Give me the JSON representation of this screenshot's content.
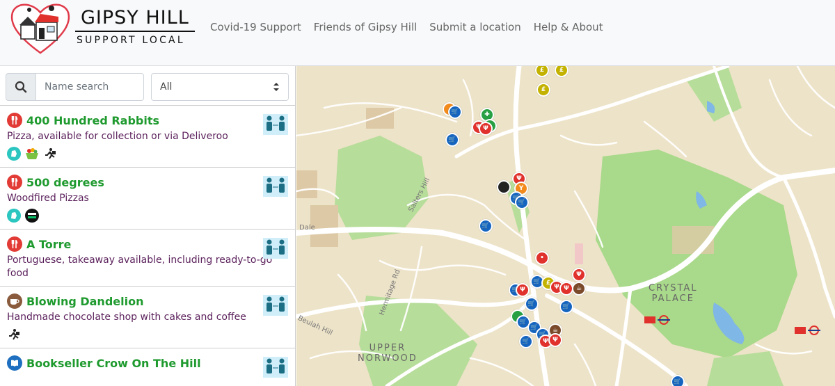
{
  "header": {
    "brand_title": "GIPSY HILL",
    "brand_subtitle": "SUPPORT LOCAL",
    "nav": [
      {
        "label": "Covid-19 Support"
      },
      {
        "label": "Friends of Gipsy Hill"
      },
      {
        "label": "Submit a location"
      },
      {
        "label": "Help & About"
      }
    ]
  },
  "search": {
    "placeholder": "Name search",
    "filter_value": "All"
  },
  "listings": [
    {
      "name": "400 Hundred Rabbits",
      "category": "food",
      "description": "Pizza, available for collection or via Deliveroo",
      "tags": [
        "deliveroo-icon",
        "basket-icon",
        "delivery-runner-icon"
      ]
    },
    {
      "name": "500 degrees",
      "category": "food",
      "description": "Woodfired Pizzas",
      "tags": [
        "deliveroo-icon",
        "uber-eats-icon"
      ]
    },
    {
      "name": "A Torre",
      "category": "food",
      "description": "Portuguese, takeaway available, including ready-to-go food",
      "tags": []
    },
    {
      "name": "Blowing Dandelion",
      "category": "coffee",
      "description": "Handmade chocolate shop with cakes and coffee",
      "tags": [
        "delivery-runner-icon"
      ]
    },
    {
      "name": "Bookseller Crow On The Hill",
      "category": "book",
      "description": "",
      "tags": []
    }
  ],
  "map": {
    "labels": {
      "crystal_palace_1": "CRYSTAL",
      "crystal_palace_2": "PALACE",
      "upper_norwood_1": "UPPER",
      "upper_norwood_2": "NORWOOD",
      "salters_hill": "Salters Hill",
      "hermitage_rd": "Hermitage Rd",
      "beulah_hill": "Beulah Hill",
      "dale": "Dale"
    }
  },
  "colors": {
    "accent_green": "#1e9a2e",
    "description_purple": "#5a1f5a",
    "map_land": "#ede3c8",
    "map_park": "#a9d98a",
    "map_road": "#ffffff"
  }
}
